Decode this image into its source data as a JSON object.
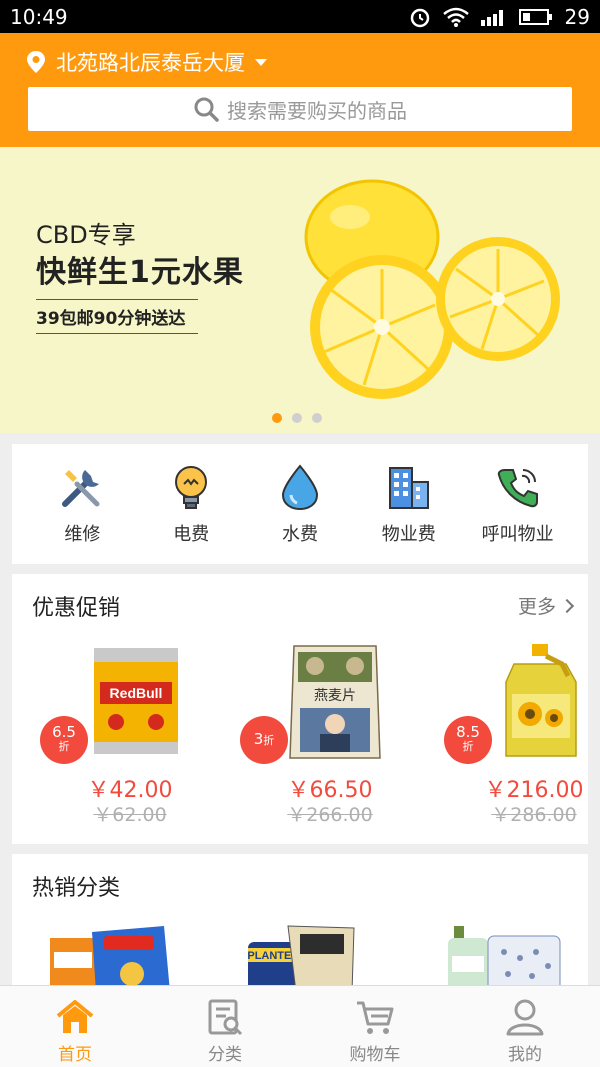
{
  "status_bar": {
    "time": "10:49",
    "battery": "29"
  },
  "header": {
    "location": "北苑路北辰泰岳大厦",
    "search_placeholder": "搜索需要购买的商品"
  },
  "banner": {
    "line1": "CBD专享",
    "line2": "快鲜生1元水果",
    "line3": "39包邮90分钟送达",
    "slide_count": 3,
    "active_slide": 1
  },
  "services": [
    {
      "label": "维修",
      "icon": "wrench-screwdriver-icon"
    },
    {
      "label": "电费",
      "icon": "lightbulb-icon"
    },
    {
      "label": "水费",
      "icon": "water-drop-icon"
    },
    {
      "label": "物业费",
      "icon": "building-icon"
    },
    {
      "label": "呼叫物业",
      "icon": "phone-icon"
    }
  ],
  "promotions": {
    "title": "优惠促销",
    "more": "更多",
    "items": [
      {
        "discount": "6.5",
        "discount_unit": "折",
        "price": "￥42.00",
        "old_price": "￥62.00",
        "image": "redbull-can"
      },
      {
        "discount": "3",
        "discount_unit": "折",
        "price": "￥66.50",
        "old_price": "￥266.00",
        "image": "oat-flakes-bag"
      },
      {
        "discount": "8.5",
        "discount_unit": "折",
        "price": "￥216.00",
        "old_price": "￥286.00",
        "image": "cooking-oil-bottle"
      }
    ]
  },
  "hot_categories": {
    "title": "热销分类"
  },
  "tabbar": [
    {
      "label": "首页",
      "icon": "home-icon",
      "active": true
    },
    {
      "label": "分类",
      "icon": "category-list-icon",
      "active": false
    },
    {
      "label": "购物车",
      "icon": "cart-icon",
      "active": false
    },
    {
      "label": "我的",
      "icon": "user-icon",
      "active": false
    }
  ],
  "colors": {
    "accent": "#ff9a0e",
    "discount": "#f24a3d"
  }
}
